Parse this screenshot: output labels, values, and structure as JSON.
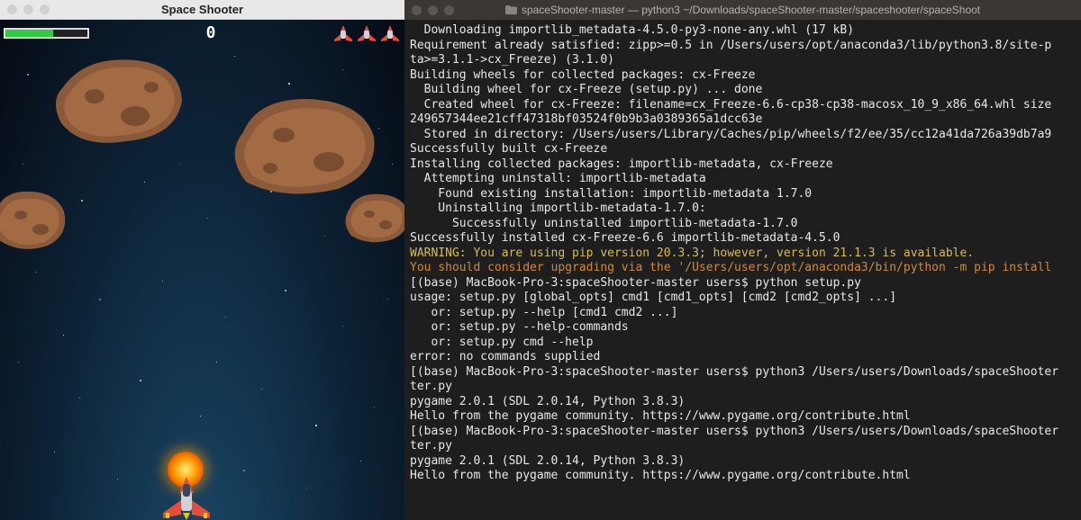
{
  "game": {
    "title": "Space Shooter",
    "score": "0",
    "health_pct": 58,
    "lives": 3
  },
  "terminal": {
    "title": "spaceShooter-master — python3 ~/Downloads/spaceShooter-master/spaceshooter/spaceShoot",
    "lines": [
      {
        "text": "  Downloading importlib_metadata-4.5.0-py3-none-any.whl (17 kB)",
        "cls": ""
      },
      {
        "text": "Requirement already satisfied: zipp>=0.5 in /Users/users/opt/anaconda3/lib/python3.8/site-p",
        "cls": ""
      },
      {
        "text": "ta>=3.1.1->cx_Freeze) (3.1.0)",
        "cls": ""
      },
      {
        "text": "Building wheels for collected packages: cx-Freeze",
        "cls": ""
      },
      {
        "text": "  Building wheel for cx-Freeze (setup.py) ... done",
        "cls": ""
      },
      {
        "text": "  Created wheel for cx-Freeze: filename=cx_Freeze-6.6-cp38-cp38-macosx_10_9_x86_64.whl size",
        "cls": ""
      },
      {
        "text": "249657344ee21cff47318bf03524f0b9b3a0389365a1dcc63e",
        "cls": ""
      },
      {
        "text": "  Stored in directory: /Users/users/Library/Caches/pip/wheels/f2/ee/35/cc12a41da726a39db7a9",
        "cls": ""
      },
      {
        "text": "Successfully built cx-Freeze",
        "cls": ""
      },
      {
        "text": "Installing collected packages: importlib-metadata, cx-Freeze",
        "cls": ""
      },
      {
        "text": "  Attempting uninstall: importlib-metadata",
        "cls": ""
      },
      {
        "text": "    Found existing installation: importlib-metadata 1.7.0",
        "cls": ""
      },
      {
        "text": "    Uninstalling importlib-metadata-1.7.0:",
        "cls": ""
      },
      {
        "text": "      Successfully uninstalled importlib-metadata-1.7.0",
        "cls": ""
      },
      {
        "text": "Successfully installed cx-Freeze-6.6 importlib-metadata-4.5.0",
        "cls": ""
      },
      {
        "text": "WARNING: You are using pip version 20.3.3; however, version 21.1.3 is available.",
        "cls": "c-yellow"
      },
      {
        "text": "You should consider upgrading via the '/Users/users/opt/anaconda3/bin/python -m pip install",
        "cls": "c-orange"
      },
      {
        "text": "[(base) MacBook-Pro-3:spaceShooter-master users$ python setup.py",
        "cls": ""
      },
      {
        "text": "usage: setup.py [global_opts] cmd1 [cmd1_opts] [cmd2 [cmd2_opts] ...]",
        "cls": ""
      },
      {
        "text": "   or: setup.py --help [cmd1 cmd2 ...]",
        "cls": ""
      },
      {
        "text": "   or: setup.py --help-commands",
        "cls": ""
      },
      {
        "text": "   or: setup.py cmd --help",
        "cls": ""
      },
      {
        "text": "",
        "cls": ""
      },
      {
        "text": "error: no commands supplied",
        "cls": ""
      },
      {
        "text": "[(base) MacBook-Pro-3:spaceShooter-master users$ python3 /Users/users/Downloads/spaceShooter",
        "cls": ""
      },
      {
        "text": "ter.py",
        "cls": ""
      },
      {
        "text": "pygame 2.0.1 (SDL 2.0.14, Python 3.8.3)",
        "cls": ""
      },
      {
        "text": "Hello from the pygame community. https://www.pygame.org/contribute.html",
        "cls": ""
      },
      {
        "text": "[(base) MacBook-Pro-3:spaceShooter-master users$ python3 /Users/users/Downloads/spaceShooter",
        "cls": ""
      },
      {
        "text": "ter.py",
        "cls": ""
      },
      {
        "text": "pygame 2.0.1 (SDL 2.0.14, Python 3.8.3)",
        "cls": ""
      },
      {
        "text": "Hello from the pygame community. https://www.pygame.org/contribute.html",
        "cls": ""
      }
    ]
  }
}
